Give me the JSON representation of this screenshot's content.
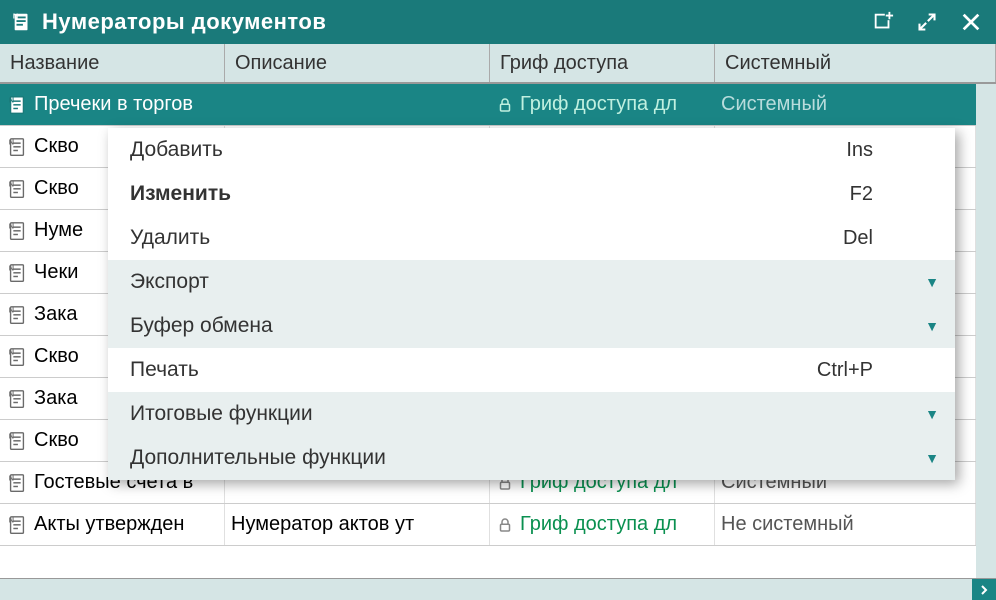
{
  "window": {
    "title": "Нумераторы документов"
  },
  "columns": {
    "name": "Название",
    "desc": "Описание",
    "access": "Гриф доступа",
    "sys": "Системный"
  },
  "rows": [
    {
      "name": "Пречеки в торгов",
      "desc": "",
      "access": "Гриф доступа дл",
      "sys": "Системный",
      "selected": true
    },
    {
      "name": "Скво",
      "desc": "",
      "access": "",
      "sys": ""
    },
    {
      "name": "Скво",
      "desc": "",
      "access": "",
      "sys": ""
    },
    {
      "name": "Нуме",
      "desc": "",
      "access": "",
      "sys": ""
    },
    {
      "name": "Чеки",
      "desc": "",
      "access": "",
      "sys": ""
    },
    {
      "name": "Зака",
      "desc": "",
      "access": "",
      "sys": ""
    },
    {
      "name": "Скво",
      "desc": "",
      "access": "",
      "sys": ""
    },
    {
      "name": "Зака",
      "desc": "",
      "access": "",
      "sys": ""
    },
    {
      "name": "Скво",
      "desc": "",
      "access": "",
      "sys": ""
    },
    {
      "name": "Гостевые счета в",
      "desc": "",
      "access": "Гриф доступа дл",
      "sys": "Системный"
    },
    {
      "name": "Акты утвержден",
      "desc": "Нумератор актов ут",
      "access": "Гриф доступа дл",
      "sys": "Не системный"
    }
  ],
  "menu": [
    {
      "label": "Добавить",
      "shortcut": "Ins",
      "type": "item"
    },
    {
      "label": "Изменить",
      "shortcut": "F2",
      "type": "item",
      "bold": true
    },
    {
      "label": "Удалить",
      "shortcut": "Del",
      "type": "item"
    },
    {
      "label": "Экспорт",
      "shortcut": "",
      "type": "sub"
    },
    {
      "label": "Буфер обмена",
      "shortcut": "",
      "type": "sub"
    },
    {
      "label": "Печать",
      "shortcut": "Ctrl+P",
      "type": "item"
    },
    {
      "label": "Итоговые функции",
      "shortcut": "",
      "type": "sub"
    },
    {
      "label": "Дополнительные функции",
      "shortcut": "",
      "type": "sub"
    }
  ]
}
